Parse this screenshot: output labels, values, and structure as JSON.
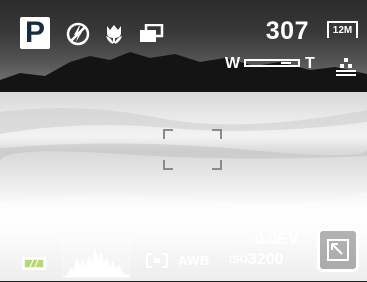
{
  "status_bar": {
    "mode": "P",
    "flash_icon": "flash-off-icon",
    "macro_icon": "macro-tulip-icon",
    "drive_icon": "continuous-shot-icon",
    "shots_remaining": "307",
    "resolution": "12M"
  },
  "zoom": {
    "wide_label": "W",
    "tele_label": "T",
    "level": 0.85,
    "quality_icon": "quality-fine-icon"
  },
  "bottom_bar": {
    "battery_icon": "battery-full-icon",
    "histogram_icon": "histogram-icon",
    "metering_icon": "center-metering-icon",
    "white_balance": "AWB",
    "exposure": "0.0EV",
    "iso_prefix": "ISO",
    "iso_value": "3200",
    "menu_button_icon": "expand-arrow-icon"
  },
  "colors": {
    "overlay_text": "#ffffff",
    "mode_badge_bg": "#ffffff",
    "mode_badge_text": "#1c2b3c"
  }
}
